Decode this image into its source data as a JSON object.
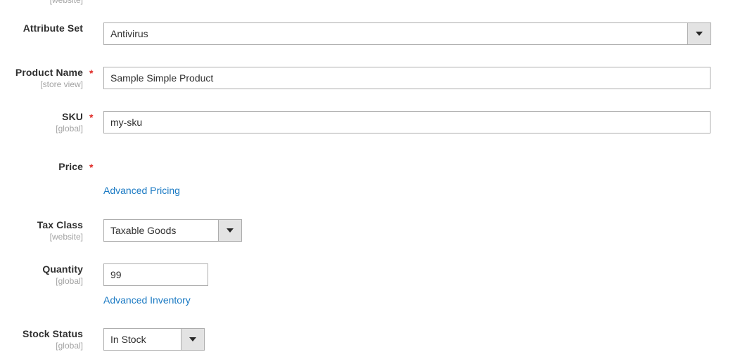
{
  "form": {
    "top_partial_scope": "[website]",
    "fields": [
      {
        "id": "attribute-set",
        "label": "Attribute Set",
        "scope": "",
        "required": false,
        "control": "select",
        "value": "Antivirus"
      },
      {
        "id": "product-name",
        "label": "Product Name",
        "scope": "[store view]",
        "required": true,
        "control": "text",
        "value": "Sample Simple Product"
      },
      {
        "id": "sku",
        "label": "SKU",
        "scope": "[global]",
        "required": true,
        "control": "text",
        "value": "my-sku"
      },
      {
        "id": "price",
        "label": "Price",
        "scope": "",
        "required": true,
        "control": "none",
        "value": ""
      },
      {
        "id": "tax-class",
        "label": "Tax Class",
        "scope": "[website]",
        "required": false,
        "control": "select",
        "value": "Taxable Goods"
      },
      {
        "id": "quantity",
        "label": "Quantity",
        "scope": "[global]",
        "required": false,
        "control": "text",
        "value": "99"
      },
      {
        "id": "stock-status",
        "label": "Stock Status",
        "scope": "[global]",
        "required": false,
        "control": "select",
        "value": "In Stock"
      }
    ],
    "links": {
      "advanced_pricing": "Advanced Pricing",
      "advanced_inventory": "Advanced Inventory"
    },
    "required_marker": "*",
    "colors": {
      "required_star": "#e02b27",
      "link": "#1979c3",
      "label": "#303030",
      "scope_note": "#a3a3a3",
      "input_border": "#adadad",
      "select_button": "#e3e3e3"
    }
  }
}
